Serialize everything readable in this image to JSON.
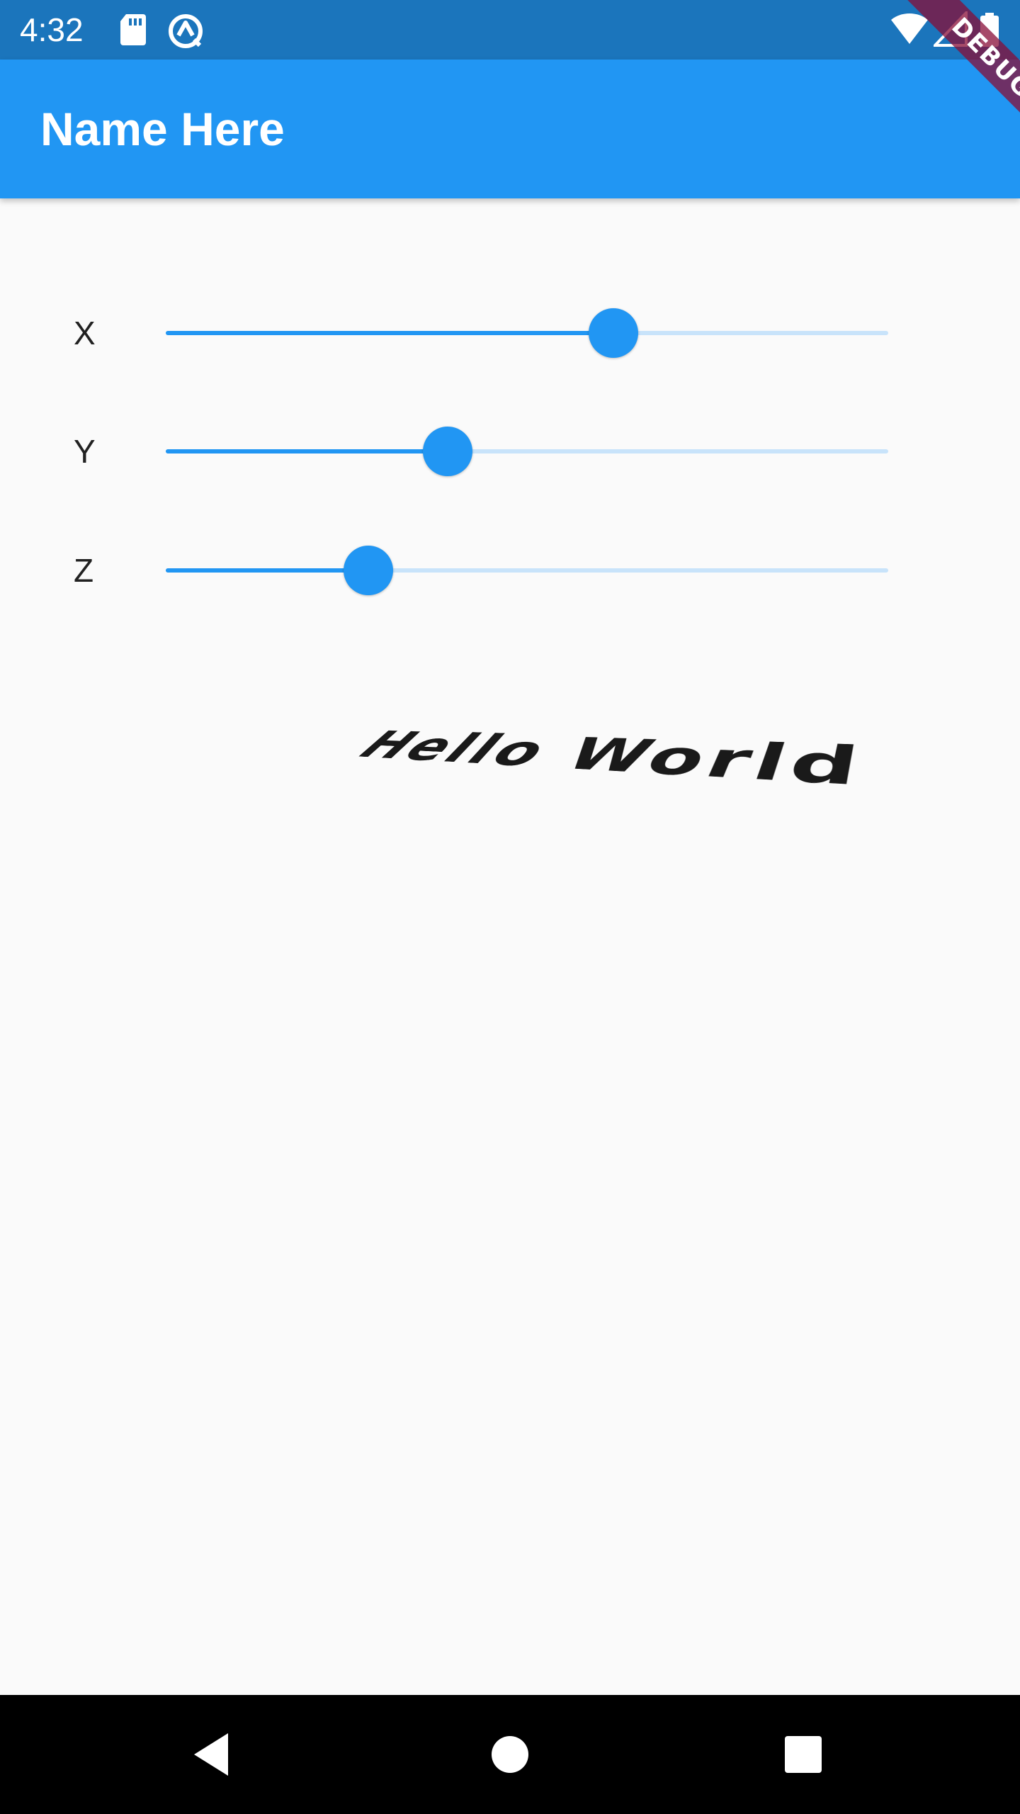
{
  "status_bar": {
    "time": "4:32",
    "icons_left": [
      "sd-card-icon",
      "data-saver-icon"
    ],
    "icons_right": [
      "wifi-icon",
      "cell-signal-icon",
      "battery-icon"
    ],
    "background": "#1b75bc"
  },
  "app_bar": {
    "title": "Name Here",
    "background": "#2196f3"
  },
  "debug_banner": {
    "label": "DEBUG"
  },
  "sliders": [
    {
      "label": "X",
      "value": 0.62
    },
    {
      "label": "Y",
      "value": 0.39
    },
    {
      "label": "Z",
      "value": 0.28
    }
  ],
  "transformed_text": "Hello World",
  "nav_bar": {
    "buttons": [
      "back-icon",
      "home-icon",
      "recents-icon"
    ]
  },
  "colors": {
    "accent": "#2196f3",
    "track_inactive": "#c8e3fa",
    "background": "#fafafa"
  }
}
